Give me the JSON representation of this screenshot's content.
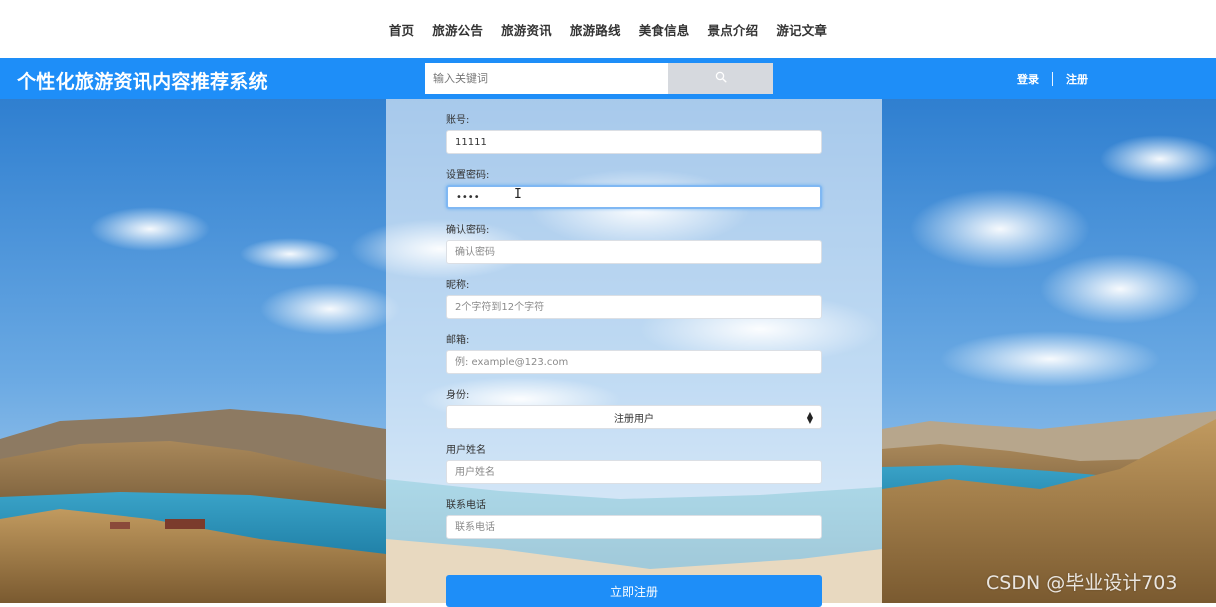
{
  "topnav": {
    "items": [
      "首页",
      "旅游公告",
      "旅游资讯",
      "旅游路线",
      "美食信息",
      "景点介绍",
      "游记文章"
    ]
  },
  "header": {
    "title": "个性化旅游资讯内容推荐系统",
    "search_placeholder": "输入关键词",
    "search_icon": "search-icon",
    "login": "登录",
    "register": "注册"
  },
  "form": {
    "account_label": "账号:",
    "account_value": "11111",
    "password_label": "设置密码:",
    "password_value": "••••",
    "confirm_label": "确认密码:",
    "confirm_placeholder": "确认密码",
    "nickname_label": "昵称:",
    "nickname_placeholder": "2个字符到12个字符",
    "email_label": "邮箱:",
    "email_placeholder": "例: example@123.com",
    "identity_label": "身份:",
    "identity_value": "注册用户",
    "realname_label": "用户姓名",
    "realname_placeholder": "用户姓名",
    "phone_label": "联系电话",
    "phone_placeholder": "联系电话",
    "submit": "立即注册"
  },
  "watermark": "CSDN @毕业设计703",
  "colors": {
    "accent": "#1e8ef8",
    "search_button": "#d6d9de",
    "sky_top": "#2f7fd0",
    "lake": "#3aa3c8"
  }
}
